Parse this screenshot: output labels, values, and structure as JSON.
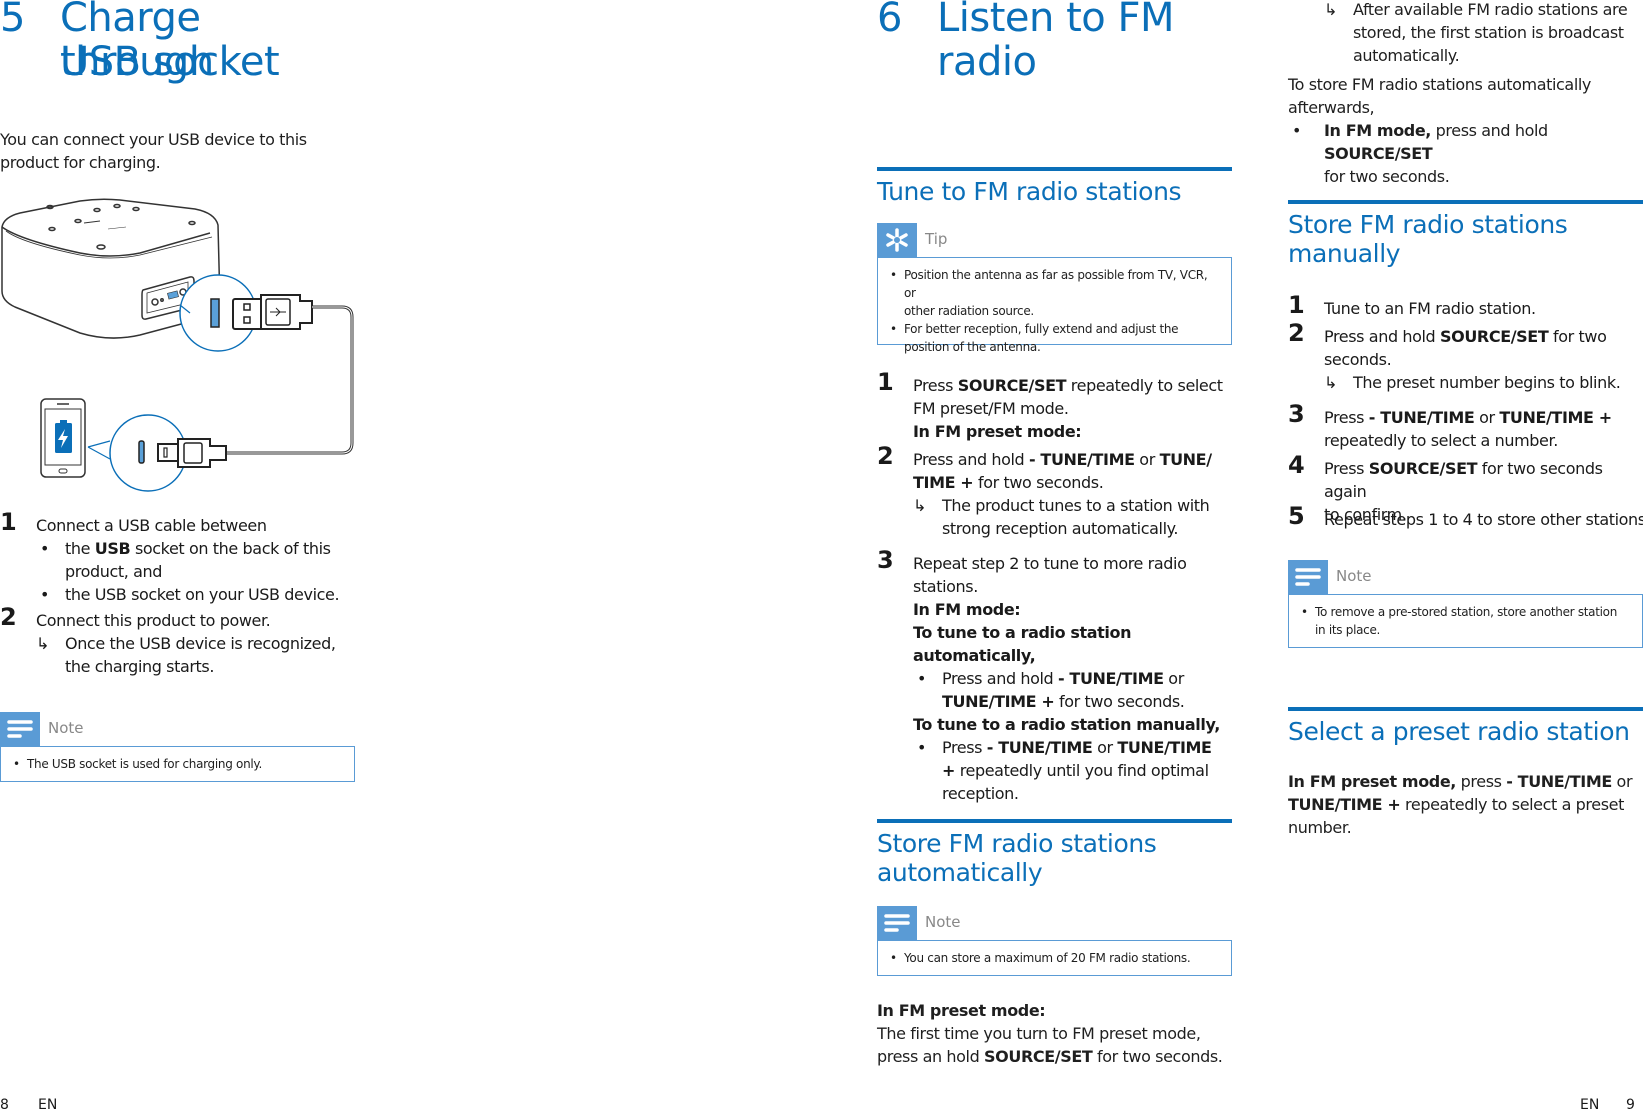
{
  "left_page": {
    "chapter_number": "5",
    "chapter_title_line1": "Charge through",
    "chapter_title_line2": "USB socket",
    "intro_line1": "You can connect your USB device to this",
    "intro_line2": "product for charging.",
    "illustration_label": "USB charging illustration",
    "steps": [
      {
        "number": "1",
        "text": "Connect a USB cable between",
        "bullets": [
          {
            "pre": "the ",
            "bold": "USB",
            "post": " socket on the back of this",
            "cont": "product, and"
          },
          {
            "pre": "the USB socket on your USB device.",
            "bold": "",
            "post": "",
            "cont": ""
          }
        ]
      },
      {
        "number": "2",
        "text": "Connect this product to power.",
        "result_line1": "Once the USB device is recognized,",
        "result_line2": "the charging starts."
      }
    ],
    "note": {
      "label": "Note",
      "items": [
        "The USB socket is used for charging only."
      ]
    },
    "page_number": "8",
    "language": "EN"
  },
  "right_page": {
    "chapter_number": "6",
    "chapter_title_line1": "Listen to FM",
    "chapter_title_line2": "radio",
    "section_tune": {
      "title": "Tune to FM radio stations",
      "tip": {
        "label": "Tip",
        "items": [
          {
            "line1": "Position the antenna as far as possible from TV, VCR, or",
            "line2": "other radiation source."
          },
          {
            "line1": "For better reception, fully extend and adjust the",
            "line2": "position of the antenna."
          }
        ]
      },
      "step1": {
        "number": "1",
        "pre": "Press ",
        "bold": "SOURCE/SET",
        "post": " repeatedly to select",
        "line2": "FM preset/FM mode.",
        "mode": "In FM preset mode:"
      },
      "step2": {
        "number": "2",
        "pre": "Press and hold ",
        "bold1": "- TUNE/TIME",
        "mid": " or ",
        "bold2": "TUNE/",
        "bold3": "TIME +",
        "post": " for two seconds.",
        "result_line1": "The product tunes to a station with",
        "result_line2": "strong reception automatically."
      },
      "step3": {
        "number": "3",
        "line1": "Repeat step 2 to tune to more radio",
        "line2": "stations.",
        "mode": "In FM mode:",
        "auto_heading": "To tune to a radio station automatically,",
        "auto_pre": "Press and hold ",
        "auto_bold1": "- TUNE/TIME",
        "auto_mid": " or",
        "auto_bold2": "TUNE/TIME +",
        "auto_post": " for two seconds.",
        "manual_heading": "To tune to a radio station manually,",
        "manual_pre": "Press ",
        "manual_bold1": "- TUNE/TIME",
        "manual_mid": " or ",
        "manual_bold2": "TUNE/TIME",
        "manual_bold3": "+",
        "manual_post": " repeatedly until you find optimal",
        "manual_line3": "reception."
      }
    },
    "section_store_auto": {
      "title_line1": "Store FM radio stations",
      "title_line2": "automatically",
      "note": {
        "label": "Note",
        "items": [
          "You can store a maximum of 20 FM radio stations."
        ]
      },
      "mode": "In FM preset mode:",
      "line1": "The first time you turn to FM preset mode,",
      "line2_pre": "press an hold ",
      "line2_bold": "SOURCE/SET",
      "line2_post": " for two seconds.",
      "result_line1": "After available FM radio stations are",
      "result_line2": "stored, the first station is broadcast",
      "result_line3": "automatically.",
      "after_line1": "To store FM radio stations automatically",
      "after_line2": "afterwards,",
      "bullet_bold": "In FM mode,",
      "bullet_mid": " press and hold ",
      "bullet_bold2": "SOURCE/SET",
      "bullet_line2": "for two seconds."
    },
    "section_store_manual": {
      "title_line1": "Store FM radio stations",
      "title_line2": "manually",
      "step1": {
        "number": "1",
        "text": "Tune to an FM radio station."
      },
      "step2": {
        "number": "2",
        "pre": "Press and hold ",
        "bold": "SOURCE/SET",
        "post": " for two",
        "line2": "seconds.",
        "result": "The preset number begins to blink."
      },
      "step3": {
        "number": "3",
        "pre": "Press ",
        "bold1": "- TUNE/TIME",
        "mid": " or ",
        "bold2": "TUNE/TIME +",
        "line2": "repeatedly to select a number."
      },
      "step4": {
        "number": "4",
        "pre": "Press ",
        "bold": "SOURCE/SET",
        "post": " for two seconds again",
        "line2": "to confirm."
      },
      "step5": {
        "number": "5",
        "text": "Repeat steps 1 to 4 to store other stations."
      },
      "note": {
        "label": "Note",
        "items": [
          {
            "line1": "To remove a pre-stored station, store another station",
            "line2": "in its place."
          }
        ]
      }
    },
    "section_select": {
      "title": "Select a preset radio station",
      "bold": "In FM preset mode,",
      "pre": " press ",
      "bold1": "- TUNE/TIME",
      "mid": " or",
      "bold2": "TUNE/TIME +",
      "post": " repeatedly to select a preset",
      "line3": "number."
    },
    "page_number": "9",
    "language": "EN"
  },
  "glyphs": {
    "arrow": "↳",
    "bullet": "•"
  },
  "colors": {
    "accent": "#0b6fb8",
    "callout": "#5a9bd5"
  }
}
